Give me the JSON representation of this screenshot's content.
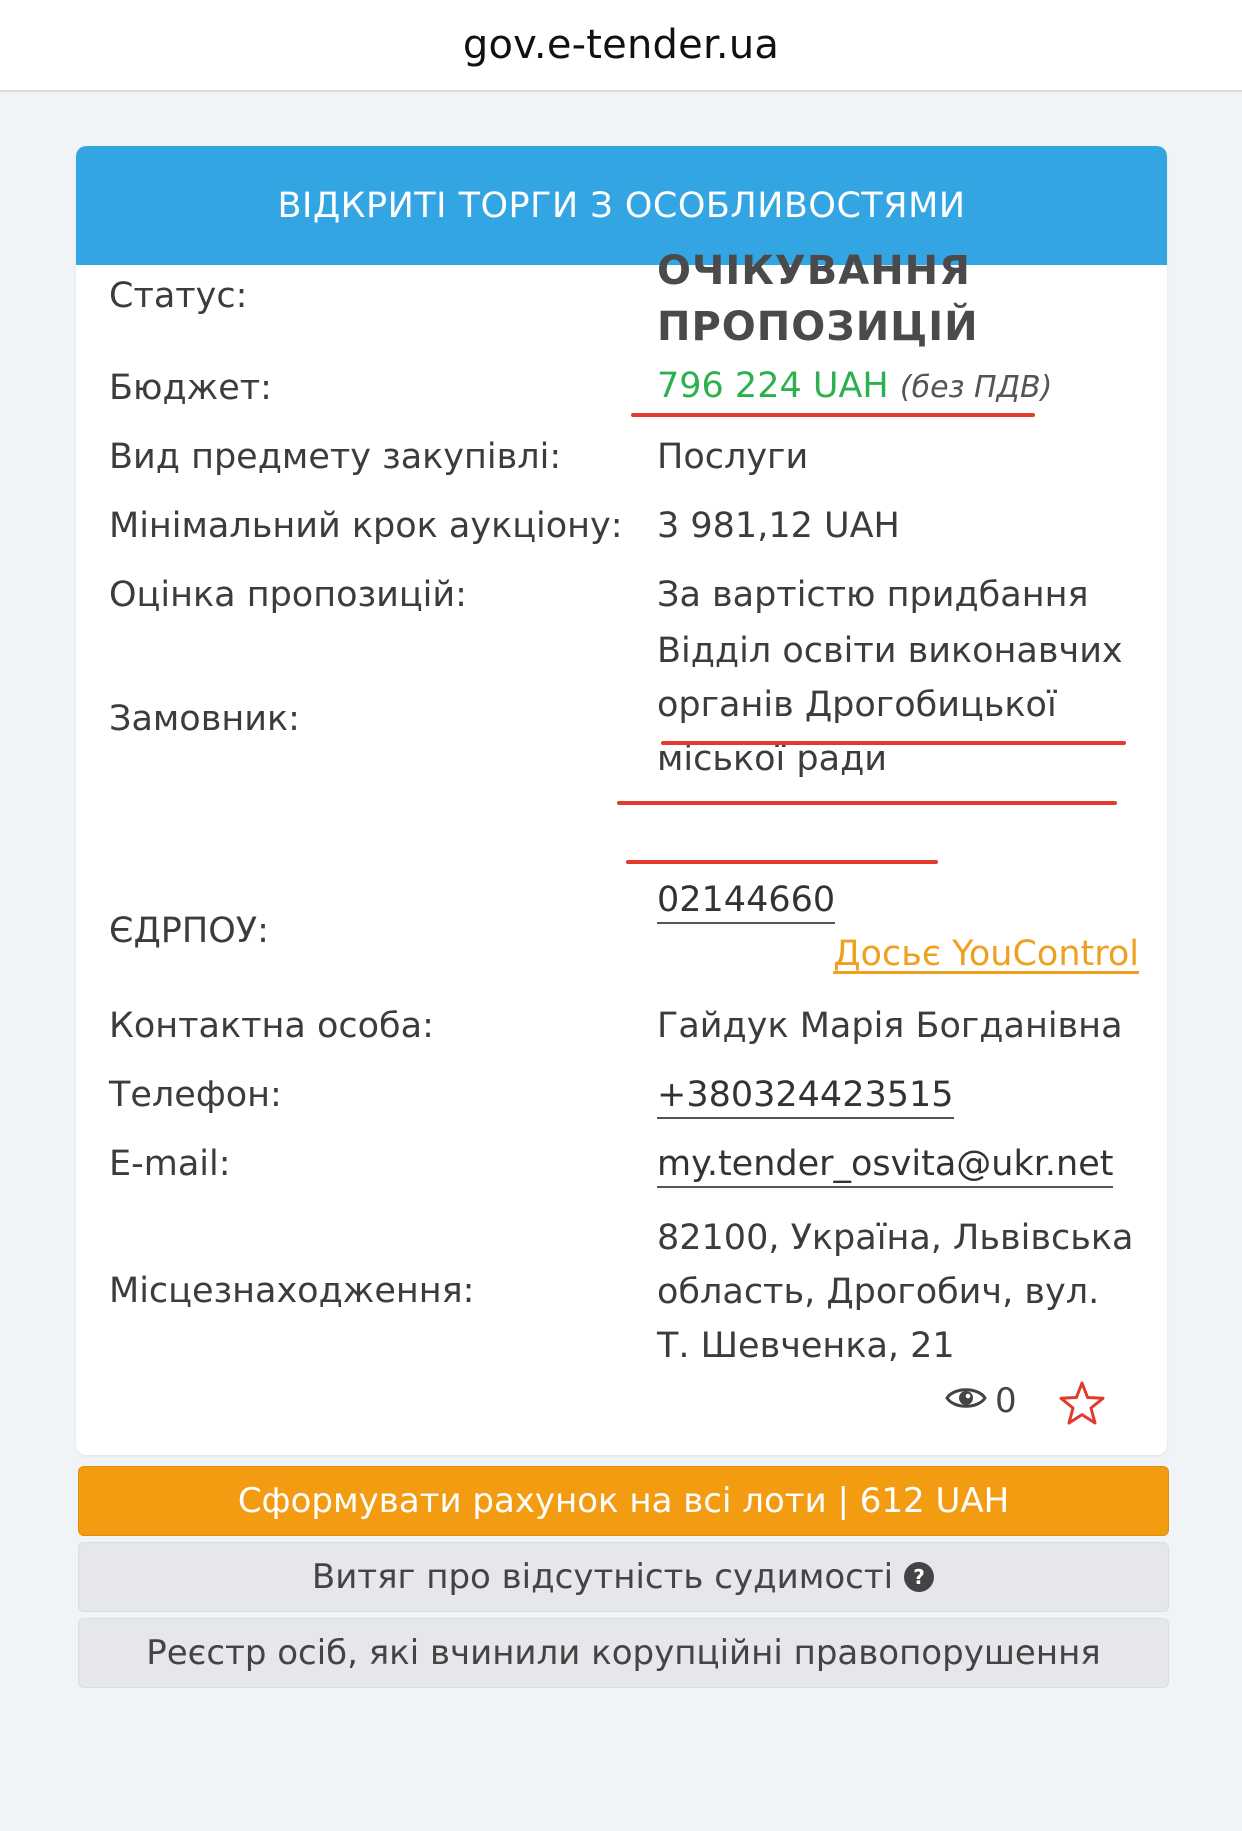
{
  "browser": {
    "url": "gov.e-tender.ua"
  },
  "tender": {
    "header": "ВІДКРИТІ ТОРГИ З ОСОБЛИВОСТЯМИ",
    "status_label": "Статус:",
    "status_value_line1": "ОЧІКУВАННЯ",
    "status_value_line2": "ПРОПОЗИЦІЙ",
    "budget_label": "Бюджет:",
    "budget_value": "796 224 UAH",
    "budget_note": "(без ПДВ)",
    "subject_label": "Вид предмету закупівлі:",
    "subject_value": "Послуги",
    "step_label": "Мінімальний крок аукціону:",
    "step_value": "3 981,12 UAH",
    "evaluation_label": "Оцінка пропозицій:",
    "evaluation_value": "За вартістю придбання",
    "customer_label": "Замовник:",
    "customer_line1": "Відділ освіти виконавчих",
    "customer_line2": "органів Дрогобицької",
    "customer_line3": "міської ради",
    "edrpou_label": "ЄДРПОУ:",
    "edrpou_value": "02144660",
    "youcontrol_link": "Досьє YouControl",
    "contact_label": "Контактна особа:",
    "contact_value": "Гайдук Марія Богданівна",
    "phone_label": "Телефон:",
    "phone_value": "+380324423515",
    "email_label": "E-mail:",
    "email_value": "my.tender_osvita@ukr.net",
    "location_label": "Місцезнаходження:",
    "location_line1": "82100, Україна, Львівська",
    "location_line2": "область, Дрогобич, вул.",
    "location_line3": "Т. Шевченка, 21",
    "views_count": "0"
  },
  "buttons": {
    "invoice": "Сформувати рахунок на всі лоти | 612 UAH",
    "criminal_record": "Витяг про відсутність судимості",
    "corruption_registry": "Реєстр осіб, які вчинили корупційні правопорушення"
  },
  "colors": {
    "header_blue": "#33a5e3",
    "budget_green": "#2eb051",
    "youcontrol_orange": "#f0a020",
    "invoice_orange": "#f39c12",
    "annotation_red": "#e23b2e"
  }
}
